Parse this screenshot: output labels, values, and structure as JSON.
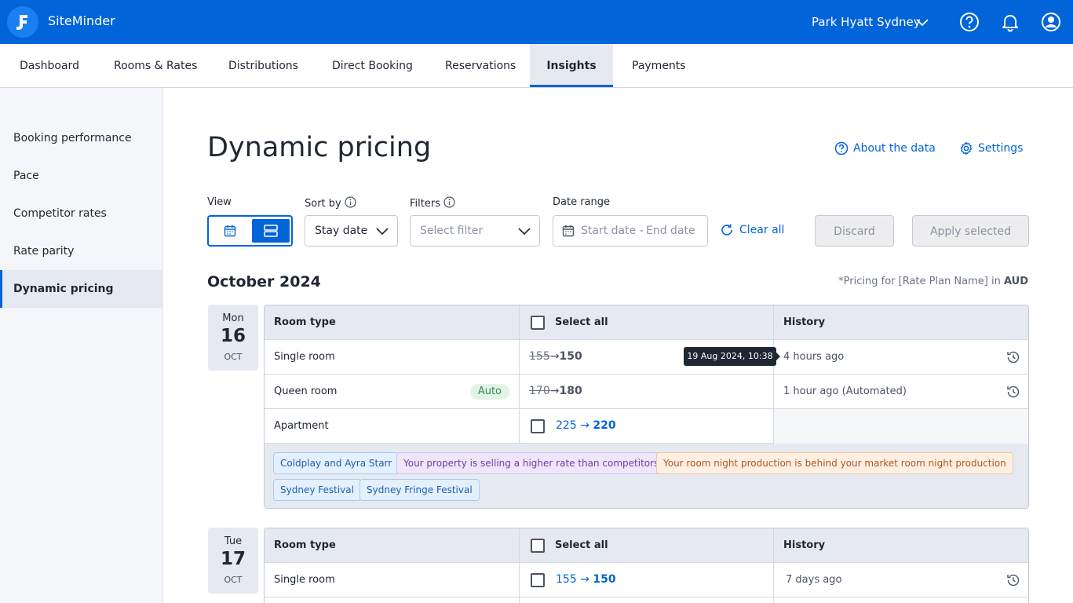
{
  "app": {
    "brand": "SiteMinder",
    "property": "Park Hyatt Sydney"
  },
  "tabs": [
    "Dashboard",
    "Rooms & Rates",
    "Distributions",
    "Direct Booking",
    "Reservations",
    "Insights",
    "Payments"
  ],
  "sidebar": [
    "Booking performance",
    "Pace",
    "Competitor rates",
    "Rate parity",
    "Dynamic pricing"
  ],
  "page": {
    "title": "Dynamic pricing",
    "about_link": "About the data",
    "settings_link": "Settings"
  },
  "controls": {
    "view_label": "View",
    "sort_label": "Sort by",
    "sort_value": "Stay date",
    "filters_label": "Filters",
    "filter_placeholder": "Select filter",
    "date_label": "Date range",
    "date_start": "Start date -",
    "date_end": "End date",
    "clear_all": "Clear all",
    "discard": "Discard",
    "apply": "Apply selected"
  },
  "month": "October 2024",
  "pricing_note": {
    "prefix": "*Pricing for [Rate Plan Name] in",
    "currency": "AUD"
  },
  "table_headers": {
    "room_type": "Room type",
    "select_all": "Select all",
    "history": "History"
  },
  "tooltip": "19 Aug 2024, 10:38",
  "days": [
    {
      "dow": "Mon",
      "day": "16",
      "mon": "OCT",
      "rows": [
        {
          "room": "Single room",
          "old": "155",
          "arrow": "→",
          "new": "150",
          "history": "4 hours ago"
        },
        {
          "room": "Queen room",
          "badge": "Auto",
          "old": "170",
          "arrow": "→",
          "new": "180",
          "history": "1 hour ago (Automated)"
        },
        {
          "room": "Apartment",
          "old": "225",
          "arrow": "→",
          "new": "220",
          "history": ""
        }
      ],
      "tags": [
        "Coldplay and Ayra Starr",
        "Your property is selling a higher rate than competitors",
        "Your room night production is behind your market room night production",
        "Sydney Festival",
        "Sydney Fringe Festival"
      ]
    },
    {
      "dow": "Tue",
      "day": "17",
      "mon": "OCT",
      "rows": [
        {
          "room": "Single room",
          "old": "155",
          "arrow": "→",
          "new": "150",
          "history": "7 days ago"
        }
      ]
    }
  ],
  "colors": {
    "primary": "#0264d9",
    "auto_badge": "#2e8a4e"
  }
}
